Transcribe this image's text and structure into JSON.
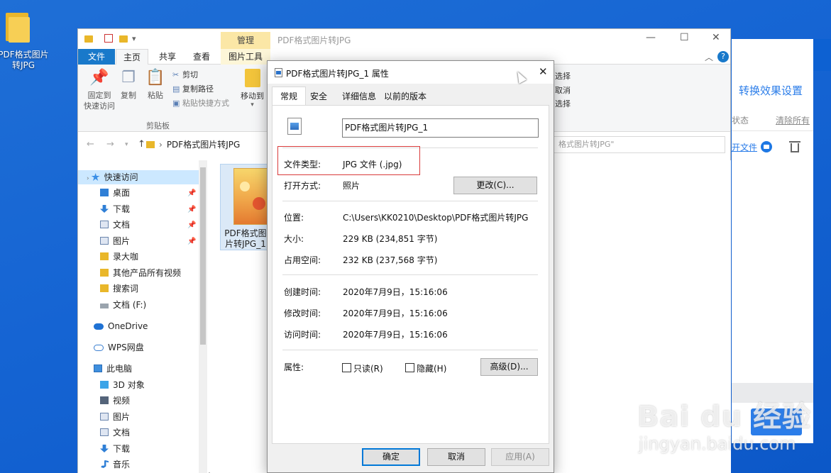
{
  "desktop": {
    "folder_label": "PDF格式图片\n转JPG"
  },
  "app": {
    "settings_link": "转换效果设置",
    "col_status": "状态",
    "clear_all": "清除所有",
    "open_file": "开文件"
  },
  "explorer": {
    "manage_tab": "管理",
    "title": "PDF格式图片转JPG",
    "tabs": {
      "file": "文件",
      "home": "主页",
      "share": "共享",
      "view": "查看",
      "picture_tools": "图片工具"
    },
    "ribbon": {
      "pin": "固定到\n快速访问",
      "copy": "复制",
      "paste": "粘贴",
      "cut": "剪切",
      "copy_path": "复制路径",
      "paste_shortcut": "粘贴快捷方式",
      "clipboard_group": "剪贴板",
      "move_to": "移动到",
      "select_all": "选择",
      "select_none": "取消",
      "invert": "选择"
    },
    "address": "PDF格式图片转JPG",
    "search_placeholder": "格式图片转JPG\"",
    "sidebar": {
      "quick_access": "快速访问",
      "desktop": "桌面",
      "downloads": "下载",
      "documents": "文档",
      "pictures": "图片",
      "lu_dakai": "录大咖",
      "other_videos": "其他产品所有视频",
      "keywords": "搜索词",
      "docs_f": "文档 (F:)",
      "onedrive": "OneDrive",
      "wps": "WPS网盘",
      "this_pc": "此电脑",
      "objects_3d": "3D 对象",
      "videos": "视频",
      "pictures2": "图片",
      "documents2": "文档",
      "downloads2": "下载",
      "music": "音乐"
    },
    "file_item_caption": "PDF格式图片转JPG_1"
  },
  "dialog": {
    "title": "PDF格式图片转JPG_1 属性",
    "tabs": [
      "常规",
      "安全",
      "详细信息",
      "以前的版本"
    ],
    "file_name": "PDF格式图片转JPG_1",
    "file_type_label": "文件类型:",
    "file_type_value": "JPG 文件 (.jpg)",
    "open_with_label": "打开方式:",
    "open_with_value": "照片",
    "change_button": "更改(C)...",
    "location_label": "位置:",
    "location_value": "C:\\Users\\KK0210\\Desktop\\PDF格式图片转JPG",
    "size_label": "大小:",
    "size_value": "229 KB (234,851 字节)",
    "size_on_disk_label": "占用空间:",
    "size_on_disk_value": "232 KB (237,568 字节)",
    "created_label": "创建时间:",
    "created_value": "2020年7月9日，15:16:06",
    "modified_label": "修改时间:",
    "modified_value": "2020年7月9日，15:16:06",
    "accessed_label": "访问时间:",
    "accessed_value": "2020年7月9日，15:16:06",
    "attributes_label": "属性:",
    "readonly_label": "只读(R)",
    "hidden_label": "隐藏(H)",
    "advanced_button": "高级(D)...",
    "ok_button": "确定",
    "cancel_button": "取消",
    "apply_button": "应用(A)",
    "highlight_color": "#d93a3a"
  },
  "watermark": {
    "main": "Bai du 经验",
    "sub": "jingyan.baidu.com"
  }
}
